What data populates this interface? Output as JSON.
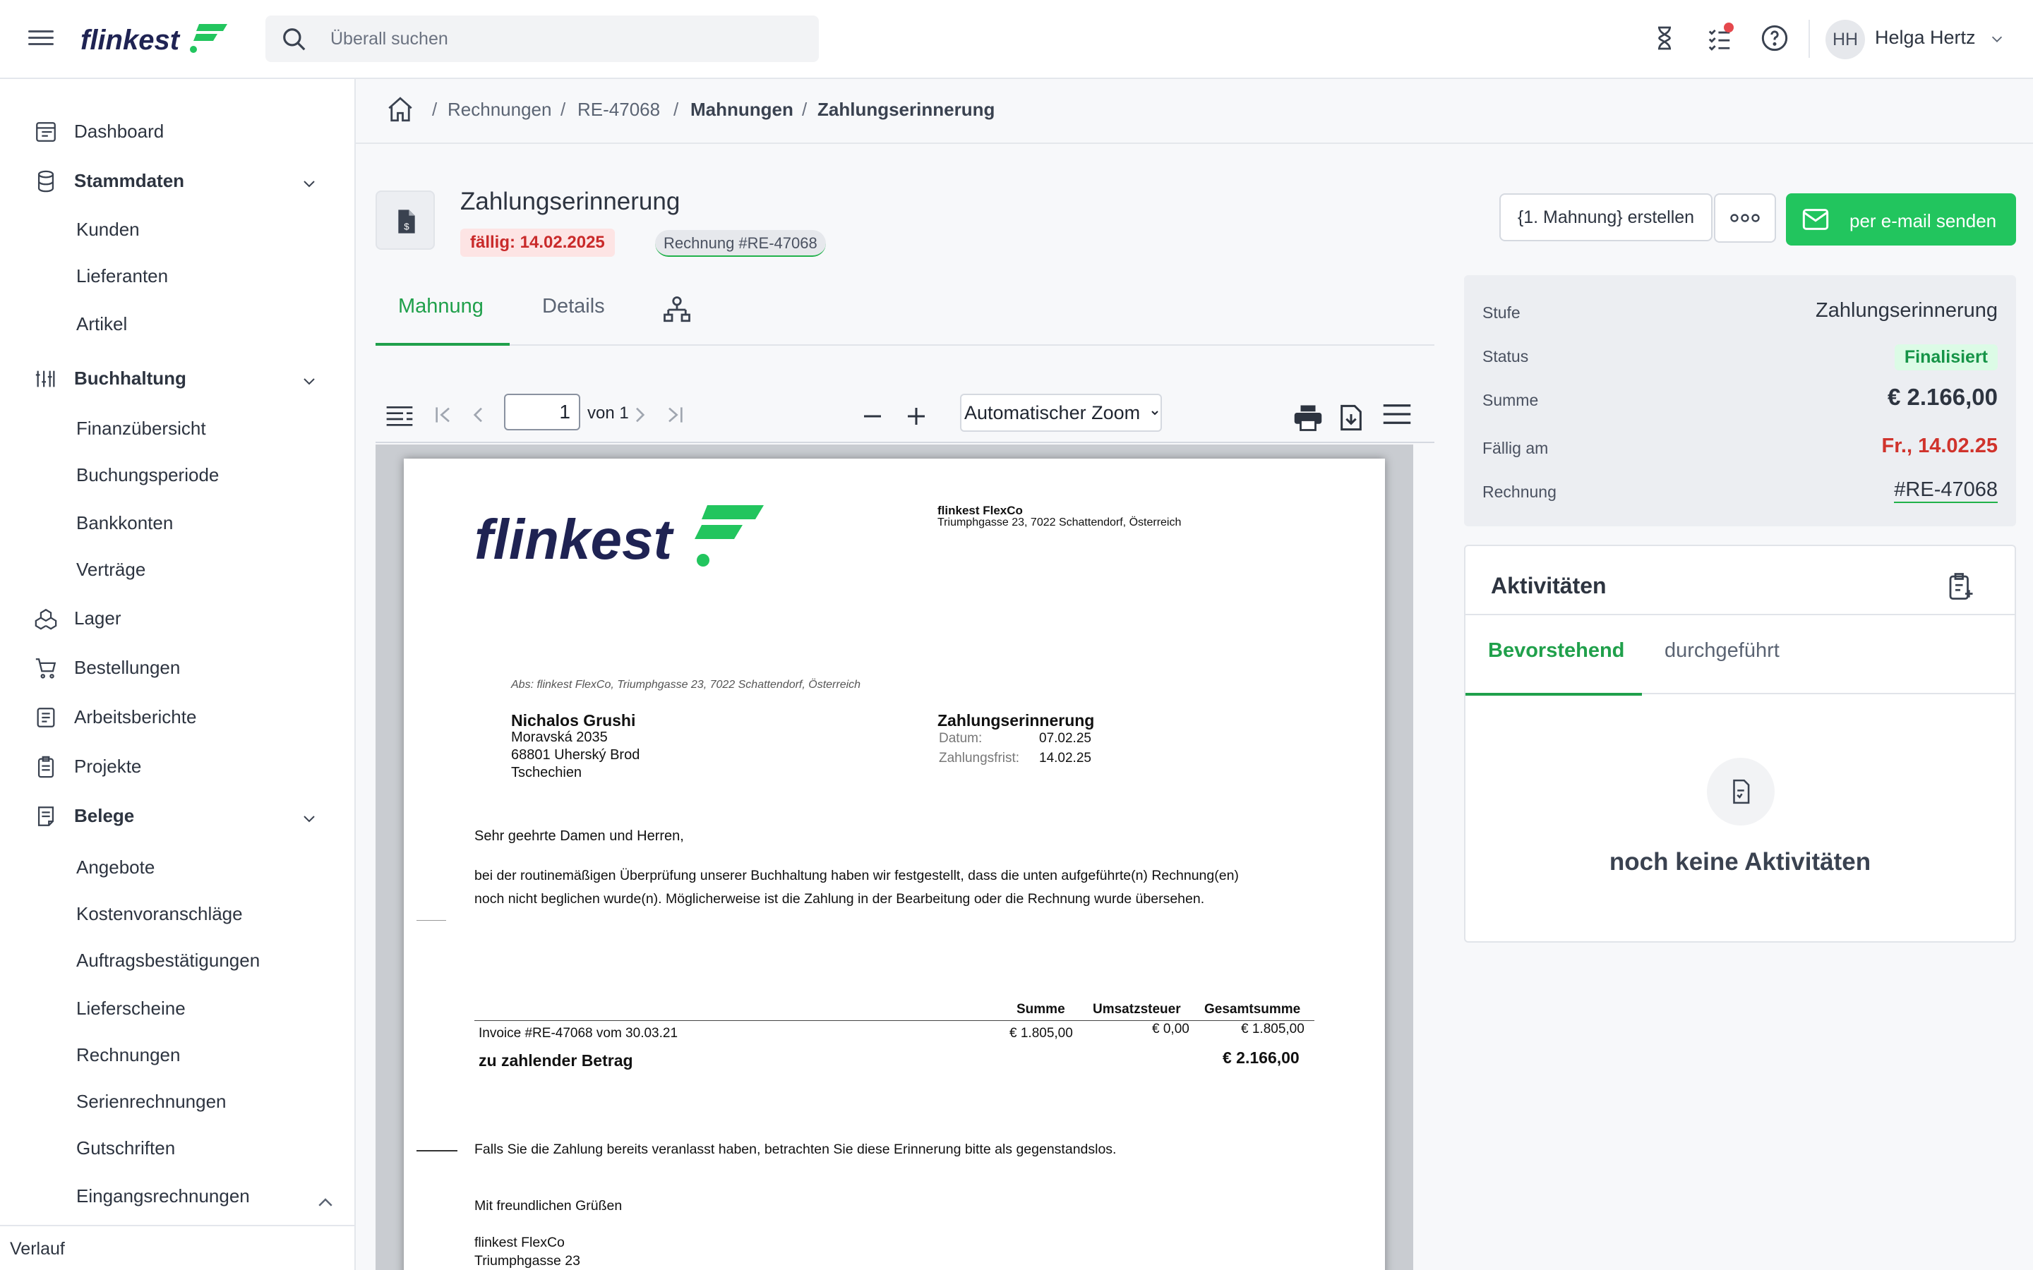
{
  "topbar": {
    "search_placeholder": "Überall suchen",
    "user_initials": "HH",
    "user_name": "Helga Hertz"
  },
  "sidebar": {
    "items": [
      {
        "label": "Dashboard"
      },
      {
        "label": "Stammdaten"
      },
      {
        "label": "Kunden"
      },
      {
        "label": "Lieferanten"
      },
      {
        "label": "Artikel"
      },
      {
        "label": "Buchhaltung"
      },
      {
        "label": "Finanzübersicht"
      },
      {
        "label": "Buchungsperiode"
      },
      {
        "label": "Bankkonten"
      },
      {
        "label": "Verträge"
      },
      {
        "label": "Lager"
      },
      {
        "label": "Bestellungen"
      },
      {
        "label": "Arbeitsberichte"
      },
      {
        "label": "Projekte"
      },
      {
        "label": "Belege"
      },
      {
        "label": "Angebote"
      },
      {
        "label": "Kostenvoranschläge"
      },
      {
        "label": "Auftragsbestätigungen"
      },
      {
        "label": "Lieferscheine"
      },
      {
        "label": "Rechnungen"
      },
      {
        "label": "Serienrechnungen"
      },
      {
        "label": "Gutschriften"
      },
      {
        "label": "Eingangsrechnungen"
      }
    ],
    "footer": "Verlauf"
  },
  "breadcrumb": [
    "Rechnungen",
    "RE-47068",
    "Mahnungen",
    "Zahlungserinnerung"
  ],
  "header": {
    "title": "Zahlungserinnerung",
    "due_badge": "fällig: 14.02.2025",
    "invoice_badge": "Rechnung #RE-47068",
    "btn_create": "{1. Mahnung} erstellen",
    "btn_email": "per e-mail senden"
  },
  "tabs": [
    "Mahnung",
    "Details"
  ],
  "pdf_toolbar": {
    "page": "1",
    "page_of": "von 1",
    "zoom": "Automatischer Zoom"
  },
  "document": {
    "company_name": "flinkest FlexCo",
    "company_address": "Triumphgasse 23, 7022 Schattendorf, Österreich",
    "sender_line": "Abs: flinkest FlexCo, Triumphgasse 23, 7022 Schattendorf, Österreich",
    "recipient": [
      "Nichalos Grushi",
      "Moravská 2035",
      "68801 Uherský Brod",
      "Tschechien"
    ],
    "doc_title": "Zahlungserinnerung",
    "date_label": "Datum:",
    "date_value": "07.02.25",
    "deadline_label": "Zahlungsfrist:",
    "deadline_value": "14.02.25",
    "greeting": "Sehr geehrte Damen und Herren,",
    "body_line1": "bei der routinemäßigen Überprüfung unserer Buchhaltung haben wir festgestellt, dass die unten aufgeführte(n) Rechnung(en)",
    "body_line2": "noch nicht beglichen wurde(n). Möglicherweise ist die Zahlung in der Bearbeitung oder die Rechnung wurde übersehen.",
    "table_headers": [
      "Summe",
      "Umsatzsteuer",
      "Gesamtsumme"
    ],
    "table_row": {
      "label": "Invoice #RE-47068 vom 30.03.21",
      "sum": "€ 1.805,00",
      "tax": "€ 0,00",
      "total": "€ 1.805,00"
    },
    "due_label": "zu zahlender Betrag",
    "due_value": "€ 2.166,00",
    "note": "Falls Sie die Zahlung bereits veranlasst haben, betrachten Sie diese Erinnerung bitte als gegenstandslos.",
    "closing": "Mit freundlichen Grüßen",
    "sign_company": "flinkest FlexCo",
    "sign_street": "Triumphgasse 23"
  },
  "summary": {
    "rows": [
      {
        "label": "Stufe",
        "value": "Zahlungserinnerung"
      },
      {
        "label": "Status",
        "value": "Finalisiert"
      },
      {
        "label": "Summe",
        "value": "€ 2.166,00"
      },
      {
        "label": "Fällig am",
        "value": "Fr., 14.02.25"
      },
      {
        "label": "Rechnung",
        "value": "#RE-47068"
      }
    ]
  },
  "activities": {
    "title": "Aktivitäten",
    "tabs": [
      "Bevorstehend",
      "durchgeführt"
    ],
    "empty": "noch keine Aktivitäten"
  },
  "colors": {
    "brand_green": "#22c55e",
    "brand_navy": "#1f2353",
    "danger": "#d0332c"
  }
}
